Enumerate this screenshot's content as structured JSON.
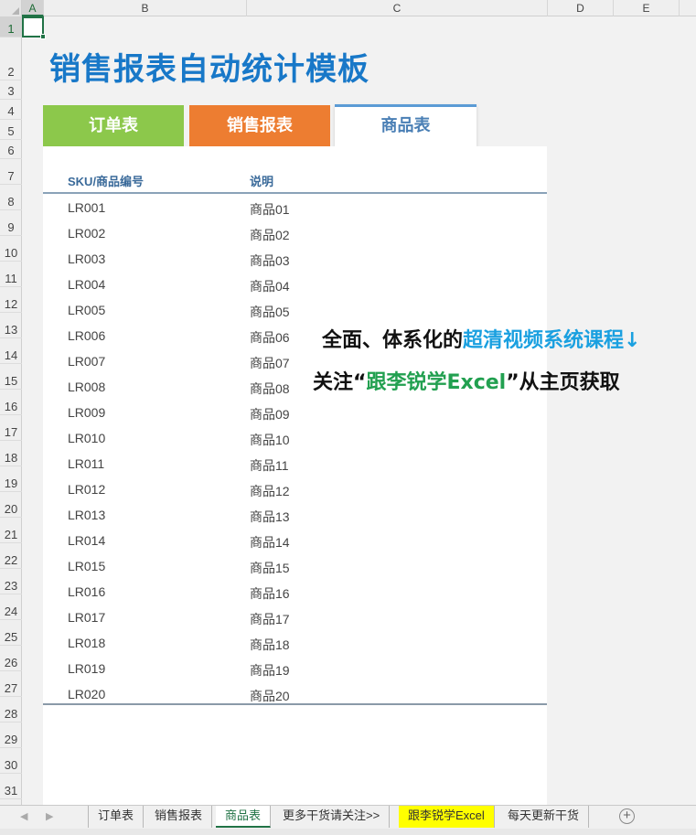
{
  "columns": [
    "A",
    "B",
    "C",
    "D",
    "E"
  ],
  "rows": [
    "1",
    "2",
    "3",
    "4",
    "5",
    "6",
    "7",
    "8",
    "9",
    "10",
    "11",
    "12",
    "13",
    "14",
    "15",
    "16",
    "17",
    "18",
    "19",
    "20",
    "21",
    "22",
    "23",
    "24",
    "25",
    "26",
    "27",
    "28",
    "29",
    "30",
    "31"
  ],
  "title": "销售报表自动统计模板",
  "nav_tabs": {
    "orders": "订单表",
    "sales": "销售报表",
    "products": "商品表"
  },
  "table": {
    "headers": {
      "sku": "SKU/商品编号",
      "desc": "说明"
    },
    "rows": [
      {
        "sku": "LR001",
        "desc": "商品01"
      },
      {
        "sku": "LR002",
        "desc": "商品02"
      },
      {
        "sku": "LR003",
        "desc": "商品03"
      },
      {
        "sku": "LR004",
        "desc": "商品04"
      },
      {
        "sku": "LR005",
        "desc": "商品05"
      },
      {
        "sku": "LR006",
        "desc": "商品06"
      },
      {
        "sku": "LR007",
        "desc": "商品07"
      },
      {
        "sku": "LR008",
        "desc": "商品08"
      },
      {
        "sku": "LR009",
        "desc": "商品09"
      },
      {
        "sku": "LR010",
        "desc": "商品10"
      },
      {
        "sku": "LR011",
        "desc": "商品11"
      },
      {
        "sku": "LR012",
        "desc": "商品12"
      },
      {
        "sku": "LR013",
        "desc": "商品13"
      },
      {
        "sku": "LR014",
        "desc": "商品14"
      },
      {
        "sku": "LR015",
        "desc": "商品15"
      },
      {
        "sku": "LR016",
        "desc": "商品16"
      },
      {
        "sku": "LR017",
        "desc": "商品17"
      },
      {
        "sku": "LR018",
        "desc": "商品18"
      },
      {
        "sku": "LR019",
        "desc": "商品19"
      },
      {
        "sku": "LR020",
        "desc": "商品20"
      }
    ]
  },
  "promo": {
    "line1_prefix": "全面、体系化的",
    "line1_highlight": "超清视频系统课程↓",
    "line2_prefix": "关注“",
    "line2_highlight": "跟李锐学Excel",
    "line2_suffix": "”从主页获取"
  },
  "sheet_tabs": {
    "orders": "订单表",
    "sales": "销售报表",
    "products": "商品表",
    "more": "更多干货请关注>>",
    "li_rui": "跟李锐学Excel",
    "daily": "每天更新干货",
    "add_icon": "plus-circle-icon"
  },
  "colors": {
    "title": "#1878c8",
    "tab_green": "#8cc84b",
    "tab_orange": "#ed7d31",
    "tab_active_border": "#5b9bd5",
    "excel_green": "#217346",
    "promo_blue": "#1aa0e0",
    "promo_green": "#22a050",
    "sheet_yellow": "#ffff00"
  }
}
